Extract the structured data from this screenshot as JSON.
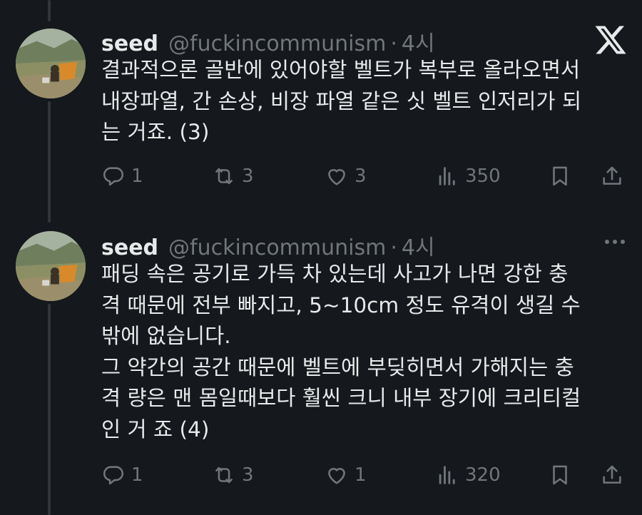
{
  "tweets": [
    {
      "name": "seed",
      "handle": "@fuckincommunism",
      "sep": "·",
      "time": "4시",
      "lines": [
        "결과적으론 골반에 있어야할 벨트가 복부로 올라오면서",
        "내장파열, 간 손상, 비장 파열 같은 싯 벨트 인저리가 되",
        "는 거죠. (3)"
      ],
      "replies": "1",
      "retweets": "3",
      "likes": "3",
      "views": "350"
    },
    {
      "name": "seed",
      "handle": "@fuckincommunism",
      "sep": "·",
      "time": "4시",
      "lines": [
        "패딩 속은 공기로 가득 차 있는데 사고가 나면 강한 충",
        "격 때문에 전부 빠지고, 5~10cm 정도 유격이 생길 수",
        "밖에 없습니다.",
        "그 약간의 공간 때문에 벨트에 부딪히면서 가해지는 충",
        "격 량은 맨 몸일때보다 훨씬 크니 내부 장기에 크리티컬",
        "인 거 죠 (4)"
      ],
      "replies": "1",
      "retweets": "3",
      "likes": "1",
      "views": "320"
    }
  ],
  "icons": {
    "brand": "x-logo-icon",
    "more": "more-icon",
    "reply": "reply-icon",
    "retweet": "retweet-icon",
    "like": "heart-icon",
    "views": "views-icon",
    "bookmark": "bookmark-icon",
    "share": "share-icon"
  },
  "colors": {
    "background": "#15181c",
    "text": "#e7e9ea",
    "muted": "#71767b",
    "thread_line": "#333639"
  }
}
